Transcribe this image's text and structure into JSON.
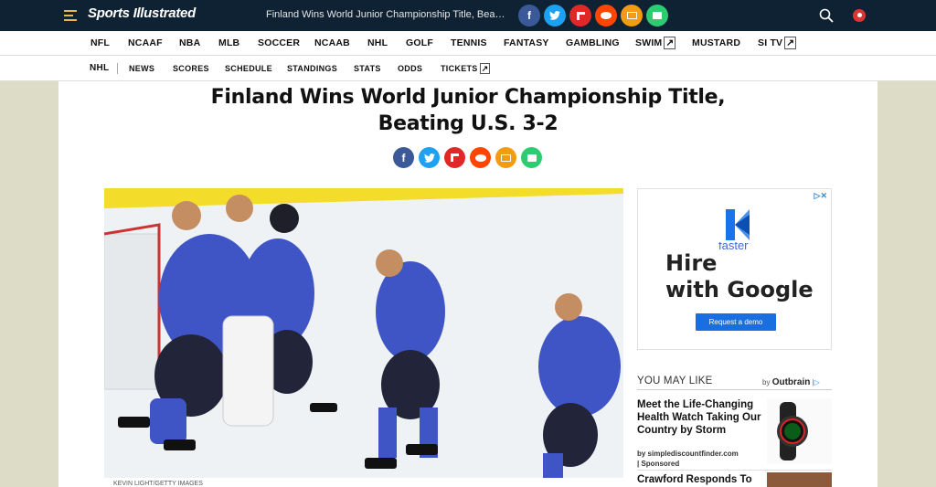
{
  "header": {
    "logo": "Sports Illustrated",
    "headline": "Finland Wins World Junior Championship Title, Beating ...",
    "share_icons": [
      "facebook-icon",
      "twitter-icon",
      "flipboard-icon",
      "reddit-icon",
      "email-icon",
      "print-icon"
    ]
  },
  "nav_primary": [
    "NFL",
    "NCAAF",
    "NBA",
    "MLB",
    "SOCCER",
    "NCAAB",
    "NHL",
    "GOLF",
    "TENNIS",
    "FANTASY",
    "GAMBLING",
    "SWIM",
    "MUSTARD",
    "SI TV"
  ],
  "nav_secondary": {
    "section": "NHL",
    "items": [
      "NEWS",
      "SCORES",
      "SCHEDULE",
      "STANDINGS",
      "STATS",
      "ODDS",
      "TICKETS"
    ]
  },
  "article": {
    "title_line1": "Finland Wins World Junior Championship Title,",
    "title_line2": "Beating U.S. 3-2",
    "photo_credit": "KEVIN LIGHT/GETTY IMAGES"
  },
  "ad": {
    "fast_text": "faster",
    "line1": "Hire",
    "line2": "with Google",
    "button": "Request a demo"
  },
  "you_may_like": {
    "heading": "YOU MAY LIKE",
    "by": "by",
    "brand": "Outbrain",
    "cards": [
      {
        "title": "Meet the Life-Changing Health Watch Taking Our Country by Storm",
        "source": "by simplediscountfinder.com",
        "sponsored": "| Sponsored"
      },
      {
        "title": "Crawford Responds To"
      }
    ]
  },
  "colors": {
    "topbar": "#0f2233",
    "facebook": "#3b5998",
    "twitter": "#1da1f2",
    "flipboard": "#e12828",
    "reddit": "#ff4500",
    "email": "#f39c12",
    "print": "#2ecc71",
    "accent": "#e8b84a"
  }
}
